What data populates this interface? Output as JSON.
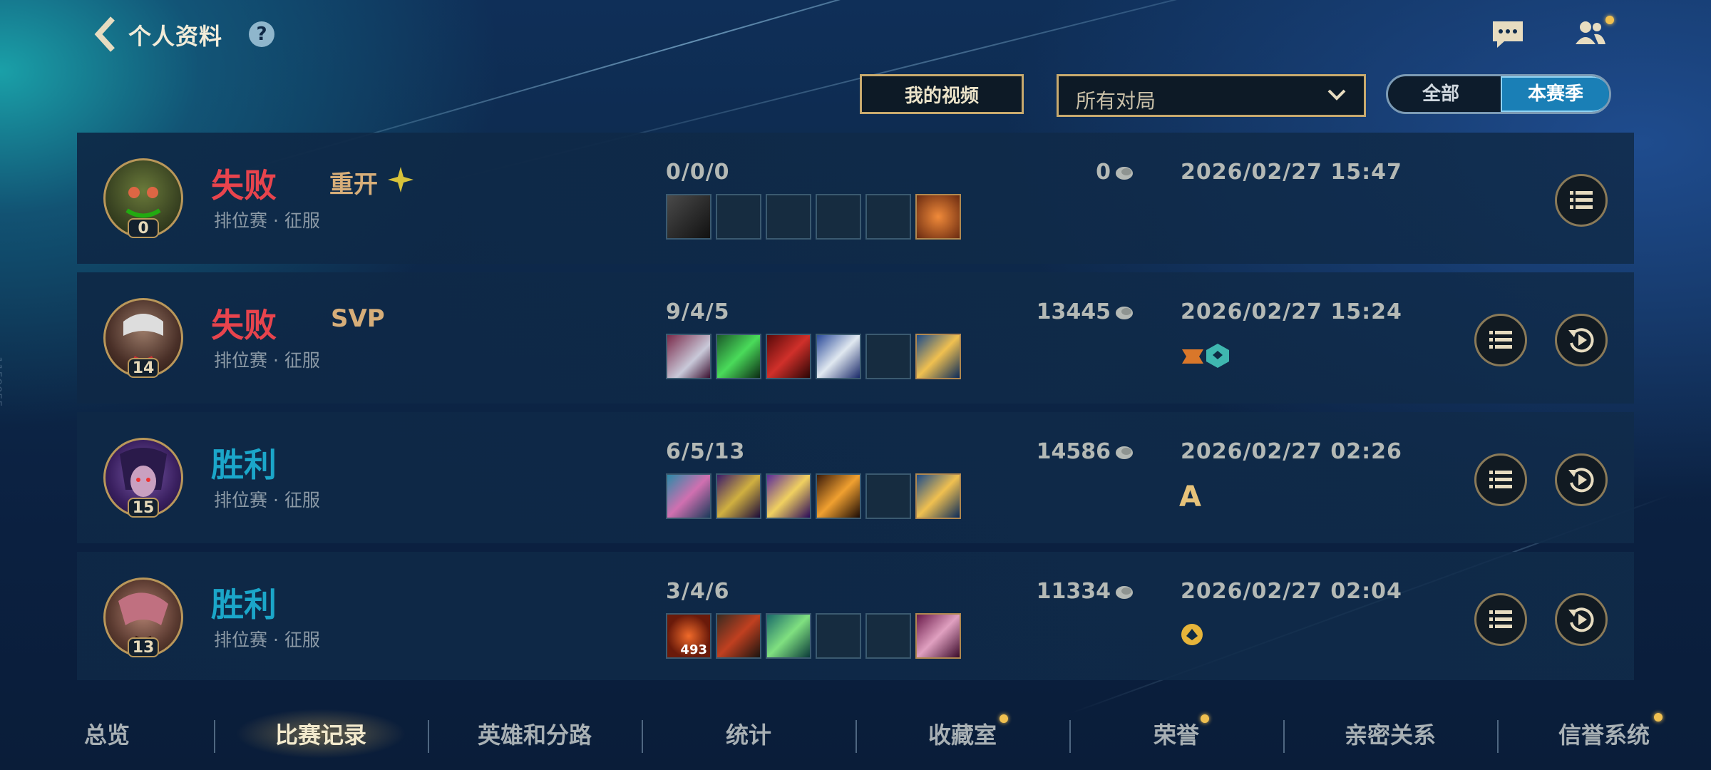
{
  "header": {
    "title": "个人资料",
    "help_glyph": "?"
  },
  "controls": {
    "video_button": "我的视频",
    "filter_value": "所有对局",
    "scope_options": [
      "全部",
      "本赛季"
    ],
    "scope_selected": "本赛季"
  },
  "matches": [
    {
      "result": "失败",
      "outcome": "loss",
      "tag": "重开",
      "mode": "排位赛 · 征服",
      "level": "0",
      "kda": "0/0/0",
      "gold": "0",
      "date": "2026/02/27 15:47",
      "items_filled": 1,
      "has_replay": false
    },
    {
      "result": "失败",
      "outcome": "loss",
      "tag": "SVP",
      "mode": "排位赛 · 征服",
      "level": "14",
      "kda": "9/4/5",
      "gold": "13445",
      "date": "2026/02/27 15:24",
      "items_filled": 4,
      "has_replay": true
    },
    {
      "result": "胜利",
      "outcome": "win",
      "tag": "",
      "mode": "排位赛 · 征服",
      "level": "15",
      "kda": "6/5/13",
      "gold": "14586",
      "date": "2026/02/27 02:26",
      "grade": "A",
      "items_filled": 4,
      "has_replay": true
    },
    {
      "result": "胜利",
      "outcome": "win",
      "tag": "",
      "mode": "排位赛 · 征服",
      "level": "13",
      "kda": "3/4/6",
      "gold": "11334",
      "date": "2026/02/27 02:04",
      "items_filled": 3,
      "item_badge": "493",
      "has_replay": true
    }
  ],
  "nav": {
    "items": [
      "总览",
      "比赛记录",
      "英雄和分路",
      "统计",
      "收藏室",
      "荣誉",
      "亲密关系",
      "信誉系统"
    ],
    "active": "比赛记录"
  },
  "watermark": "1159055",
  "colors": {
    "loss": "#e8444d",
    "win": "#1ba6c9",
    "gold_border": "#c8aa6e",
    "accent_blue": "#1a7fb6"
  }
}
